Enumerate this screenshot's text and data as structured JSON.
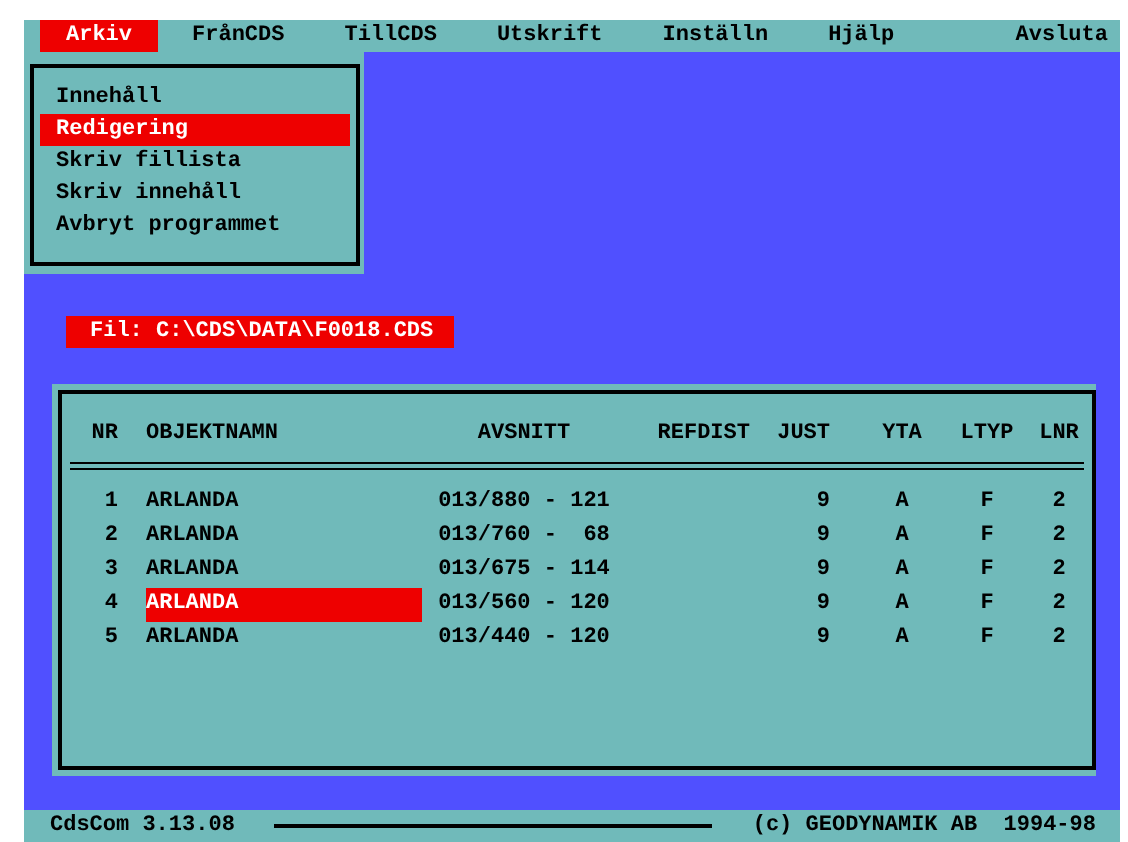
{
  "menubar": {
    "items": [
      {
        "label": "Arkiv",
        "selected": true
      },
      {
        "label": "FrånCDS",
        "selected": false
      },
      {
        "label": "TillCDS",
        "selected": false
      },
      {
        "label": "Utskrift",
        "selected": false
      },
      {
        "label": "Inställn",
        "selected": false
      },
      {
        "label": "Hjälp",
        "selected": false
      }
    ],
    "exit": "Avsluta"
  },
  "dropdown": {
    "items": [
      {
        "label": "Innehåll",
        "selected": false
      },
      {
        "label": "Redigering",
        "selected": true
      },
      {
        "label": "Skriv fillista",
        "selected": false
      },
      {
        "label": "Skriv innehåll",
        "selected": false
      },
      {
        "label": "Avbryt programmet",
        "selected": false
      }
    ]
  },
  "file_label": "Fil: C:\\CDS\\DATA\\F0018.CDS",
  "table": {
    "columns": [
      "NR",
      "OBJEKTNAMN",
      "AVSNITT",
      "REFDIST",
      "JUST",
      "YTA",
      "LTYP",
      "LNR"
    ],
    "rows": [
      {
        "nr": "1",
        "name": "ARLANDA",
        "avsnitt": "013/880 - 121",
        "just": "9",
        "yta": "A",
        "ltyp": "F",
        "lnr": "2",
        "selected": false
      },
      {
        "nr": "2",
        "name": "ARLANDA",
        "avsnitt": "013/760 -  68",
        "just": "9",
        "yta": "A",
        "ltyp": "F",
        "lnr": "2",
        "selected": false
      },
      {
        "nr": "3",
        "name": "ARLANDA",
        "avsnitt": "013/675 - 114",
        "just": "9",
        "yta": "A",
        "ltyp": "F",
        "lnr": "2",
        "selected": false
      },
      {
        "nr": "4",
        "name": "ARLANDA",
        "avsnitt": "013/560 - 120",
        "just": "9",
        "yta": "A",
        "ltyp": "F",
        "lnr": "2",
        "selected": true
      },
      {
        "nr": "5",
        "name": "ARLANDA",
        "avsnitt": "013/440 - 120",
        "just": "9",
        "yta": "A",
        "ltyp": "F",
        "lnr": "2",
        "selected": false
      }
    ]
  },
  "status_bar": {
    "version": "CdsCom 3.13.08",
    "copyright": "(c) GEODYNAMIK AB  1994-98"
  }
}
